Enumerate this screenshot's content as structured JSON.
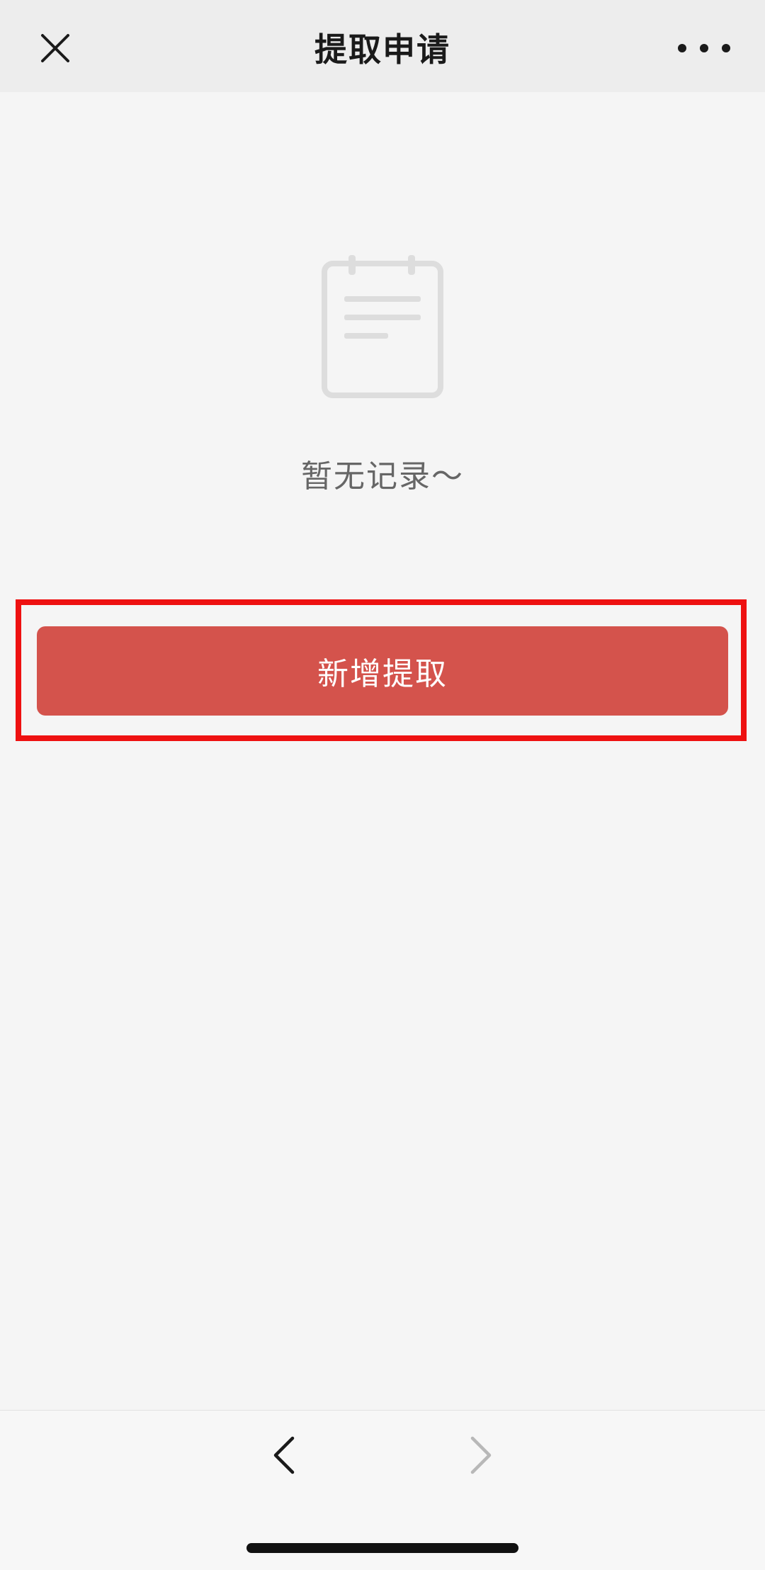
{
  "header": {
    "title": "提取申请",
    "close_icon": "close-icon",
    "more_icon": "more-dots-icon"
  },
  "empty_state": {
    "icon": "notepad-icon",
    "message": "暂无记录～"
  },
  "actions": {
    "add_label": "新增提取"
  },
  "nav": {
    "back_icon": "chevron-left-icon",
    "forward_icon": "chevron-right-icon"
  },
  "colors": {
    "primary_button": "#d4534c",
    "highlight": "#ee1111",
    "header_bg": "#ededed",
    "page_bg": "#f5f5f5"
  }
}
